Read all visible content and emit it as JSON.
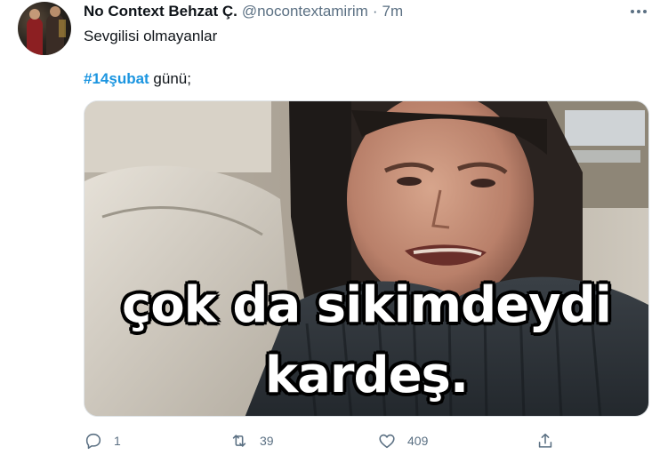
{
  "tweet": {
    "author_name": "No Context Behzat Ç.",
    "handle": "@nocontextamirim",
    "separator": "·",
    "time": "7m",
    "text_line1": "Sevgilisi olmayanlar",
    "hashtag": "#14şubat",
    "text_line2_rest": " günü;",
    "media": {
      "caption_line1": "çok da sikimdeydi",
      "caption_line2": "kardeş."
    },
    "actions": {
      "reply_count": "1",
      "retweet_count": "39",
      "like_count": "409"
    }
  },
  "icons": {
    "more": "more-horizontal-icon",
    "reply": "reply-icon",
    "retweet": "retweet-icon",
    "like": "heart-icon",
    "share": "share-icon"
  },
  "colors": {
    "hashtag": "#1b95e0",
    "secondary_text": "#5b7083",
    "primary_text": "#0f1419"
  }
}
